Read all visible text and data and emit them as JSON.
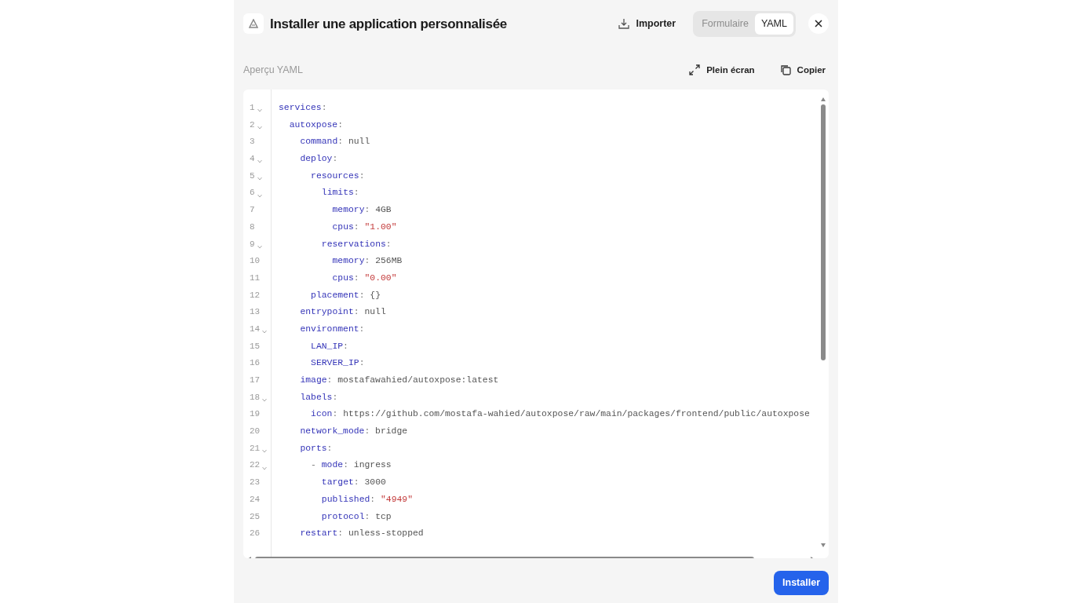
{
  "header": {
    "title": "Installer une application personnalisée",
    "import_button": "Importer",
    "modes": [
      {
        "label": "Formulaire",
        "selected": false
      },
      {
        "label": "YAML",
        "selected": true
      }
    ]
  },
  "preview": {
    "label": "Aperçu YAML",
    "actions": [
      {
        "kind": "fullscreen",
        "label": "Plein écran"
      },
      {
        "kind": "copy",
        "label": "Copier"
      }
    ]
  },
  "editor": {
    "lines": [
      {
        "number": "1",
        "foldable": true,
        "key": "services",
        "sep": ":",
        "children": [
          {
            "number": "2",
            "foldable": true,
            "key": "autoxpose",
            "sep": ":",
            "children": [
              {
                "number": "3",
                "foldable": false,
                "key": "command",
                "sep": ":",
                "value": "null",
                "kind": "plain"
              },
              {
                "number": "4",
                "foldable": true,
                "key": "deploy",
                "sep": ":",
                "children": [
                  {
                    "number": "5",
                    "foldable": true,
                    "key": "resources",
                    "sep": ":",
                    "children": [
                      {
                        "number": "6",
                        "foldable": true,
                        "key": "limits",
                        "sep": ":",
                        "children": [
                          {
                            "number": "7",
                            "foldable": false,
                            "key": "memory",
                            "sep": ":",
                            "value": "4GB",
                            "kind": "plain"
                          },
                          {
                            "number": "8",
                            "foldable": false,
                            "key": "cpus",
                            "sep": ":",
                            "value": "\"1.00\"",
                            "kind": "string"
                          }
                        ]
                      },
                      {
                        "number": "9",
                        "foldable": true,
                        "key": "reservations",
                        "sep": ":",
                        "children": [
                          {
                            "number": "10",
                            "foldable": false,
                            "key": "memory",
                            "sep": ":",
                            "value": "256MB",
                            "kind": "plain"
                          },
                          {
                            "number": "11",
                            "foldable": false,
                            "key": "cpus",
                            "sep": ":",
                            "value": "\"0.00\"",
                            "kind": "string"
                          }
                        ]
                      }
                    ]
                  },
                  {
                    "number": "12",
                    "foldable": false,
                    "key": "placement",
                    "sep": ":",
                    "value": "{}",
                    "kind": "plain"
                  }
                ]
              },
              {
                "number": "13",
                "foldable": false,
                "key": "entrypoint",
                "sep": ":",
                "value": "null",
                "kind": "plain"
              },
              {
                "number": "14",
                "foldable": true,
                "key": "environment",
                "sep": ":",
                "children": [
                  {
                    "number": "15",
                    "foldable": false,
                    "key": "LAN_IP",
                    "sep": ":"
                  },
                  {
                    "number": "16",
                    "foldable": false,
                    "key": "SERVER_IP",
                    "sep": ":"
                  }
                ]
              },
              {
                "number": "17",
                "foldable": false,
                "key": "image",
                "sep": ":",
                "value": "mostafawahied/autoxpose:latest",
                "kind": "plain"
              },
              {
                "number": "18",
                "foldable": true,
                "key": "labels",
                "sep": ":",
                "children": [
                  {
                    "number": "19",
                    "foldable": false,
                    "key": "icon",
                    "sep": ":",
                    "value": "https://github.com/mostafa-wahied/autoxpose/raw/main/packages/frontend/public/autoxpose",
                    "kind": "plain"
                  }
                ]
              },
              {
                "number": "20",
                "foldable": false,
                "key": "network_mode",
                "sep": ":",
                "value": "bridge",
                "kind": "plain"
              },
              {
                "number": "21",
                "foldable": true,
                "key": "ports",
                "sep": ":",
                "children": [
                  {
                    "number": "22",
                    "foldable": true,
                    "prefix": "-",
                    "key": "mode",
                    "sep": ":",
                    "value": "ingress",
                    "kind": "plain",
                    "children": [
                      {
                        "number": "23",
                        "foldable": false,
                        "key": "target",
                        "sep": ":",
                        "value": "3000",
                        "kind": "plain"
                      },
                      {
                        "number": "24",
                        "foldable": false,
                        "key": "published",
                        "sep": ":",
                        "value": "\"4949\"",
                        "kind": "string"
                      },
                      {
                        "number": "25",
                        "foldable": false,
                        "key": "protocol",
                        "sep": ":",
                        "value": "tcp",
                        "kind": "plain"
                      }
                    ]
                  }
                ]
              },
              {
                "number": "26",
                "foldable": false,
                "key": "restart",
                "sep": ":",
                "value": "unless-stopped",
                "kind": "plain"
              }
            ]
          }
        ]
      }
    ]
  },
  "footer": {
    "install_button": "Installer"
  }
}
